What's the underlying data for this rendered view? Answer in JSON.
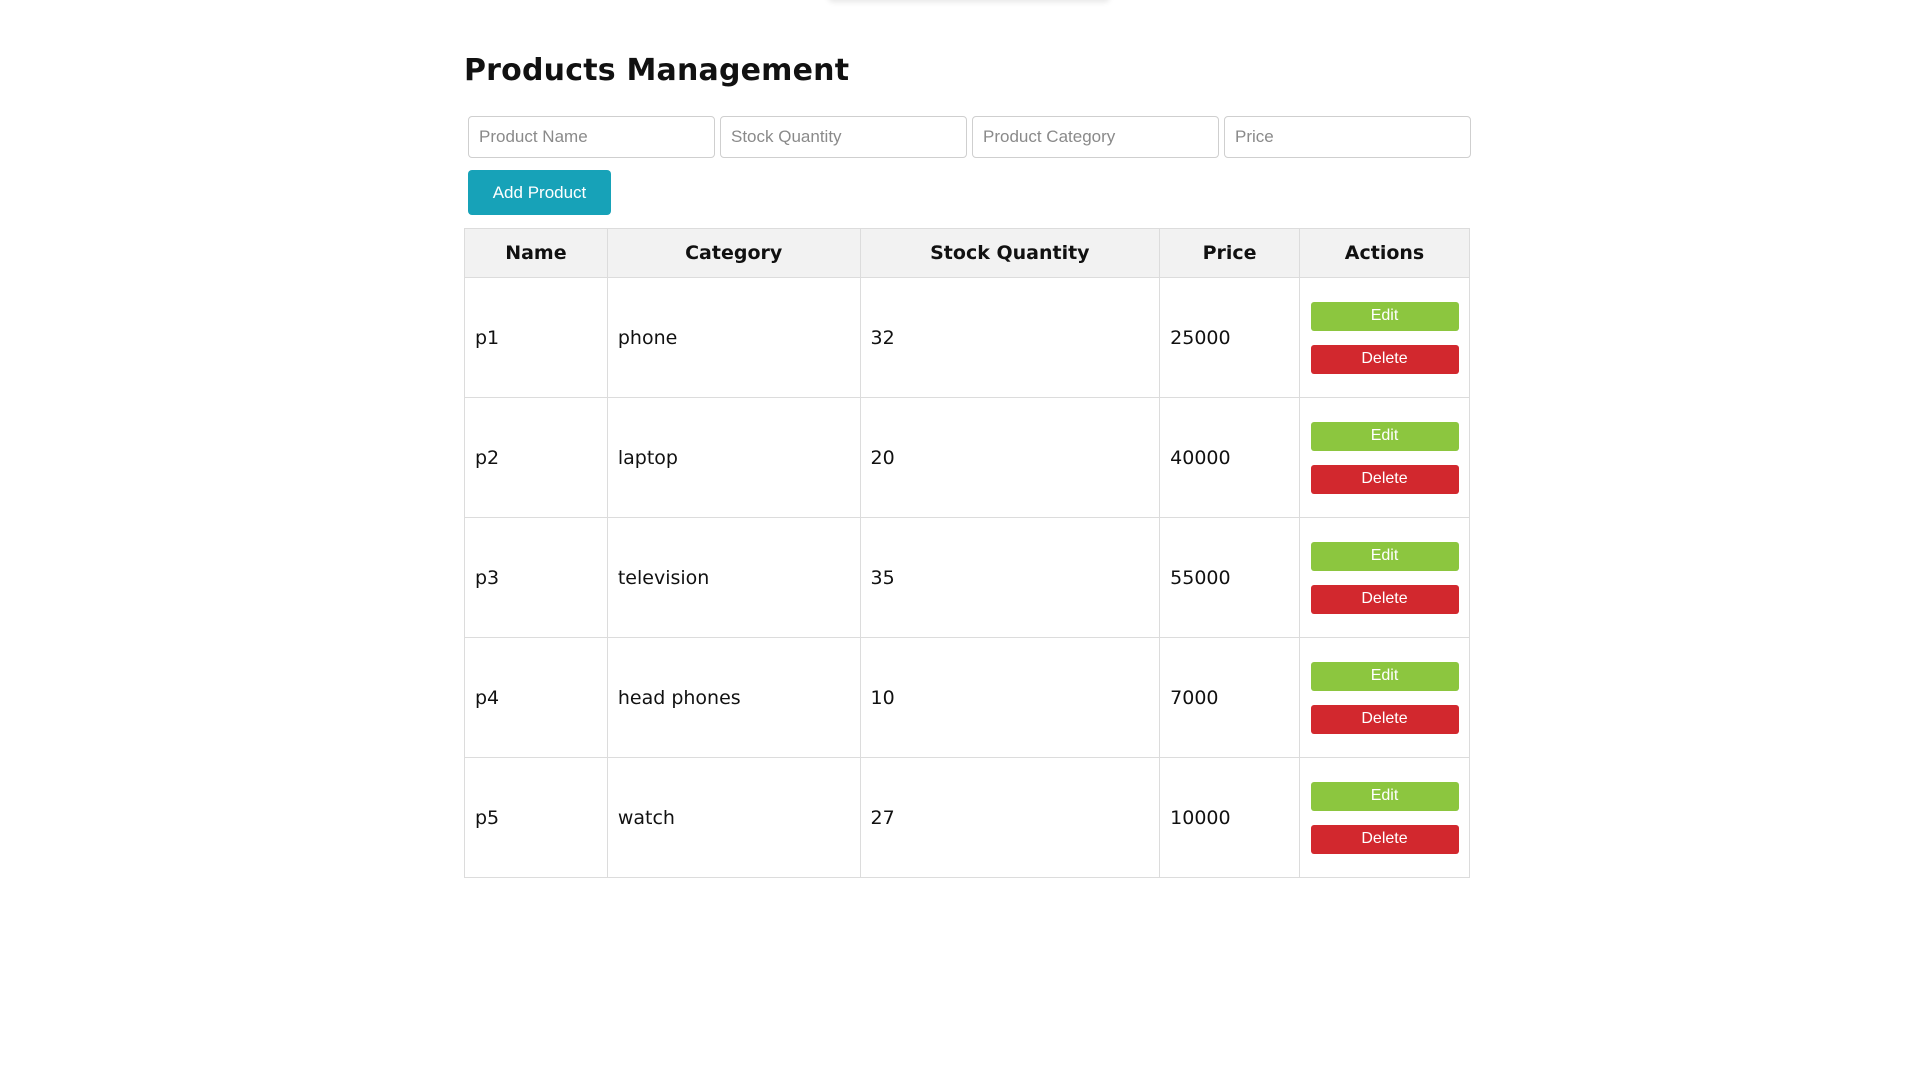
{
  "page": {
    "title": "Products Management"
  },
  "form": {
    "name_placeholder": "Product Name",
    "stock_placeholder": "Stock Quantity",
    "category_placeholder": "Product Category",
    "price_placeholder": "Price",
    "add_button_label": "Add Product"
  },
  "table": {
    "headers": [
      "Name",
      "Category",
      "Stock Quantity",
      "Price",
      "Actions"
    ],
    "rows": [
      {
        "name": "p1",
        "category": "phone",
        "stock": "32",
        "price": "25000"
      },
      {
        "name": "p2",
        "category": "laptop",
        "stock": "20",
        "price": "40000"
      },
      {
        "name": "p3",
        "category": "television",
        "stock": "35",
        "price": "55000"
      },
      {
        "name": "p4",
        "category": "head phones",
        "stock": "10",
        "price": "7000"
      },
      {
        "name": "p5",
        "category": "watch",
        "stock": "27",
        "price": "10000"
      }
    ],
    "edit_label": "Edit",
    "delete_label": "Delete"
  },
  "colors": {
    "add_button": "#17a2b8",
    "edit_button": "#8cc63f",
    "delete_button": "#d2282e",
    "header_background": "#f2f2f2"
  }
}
